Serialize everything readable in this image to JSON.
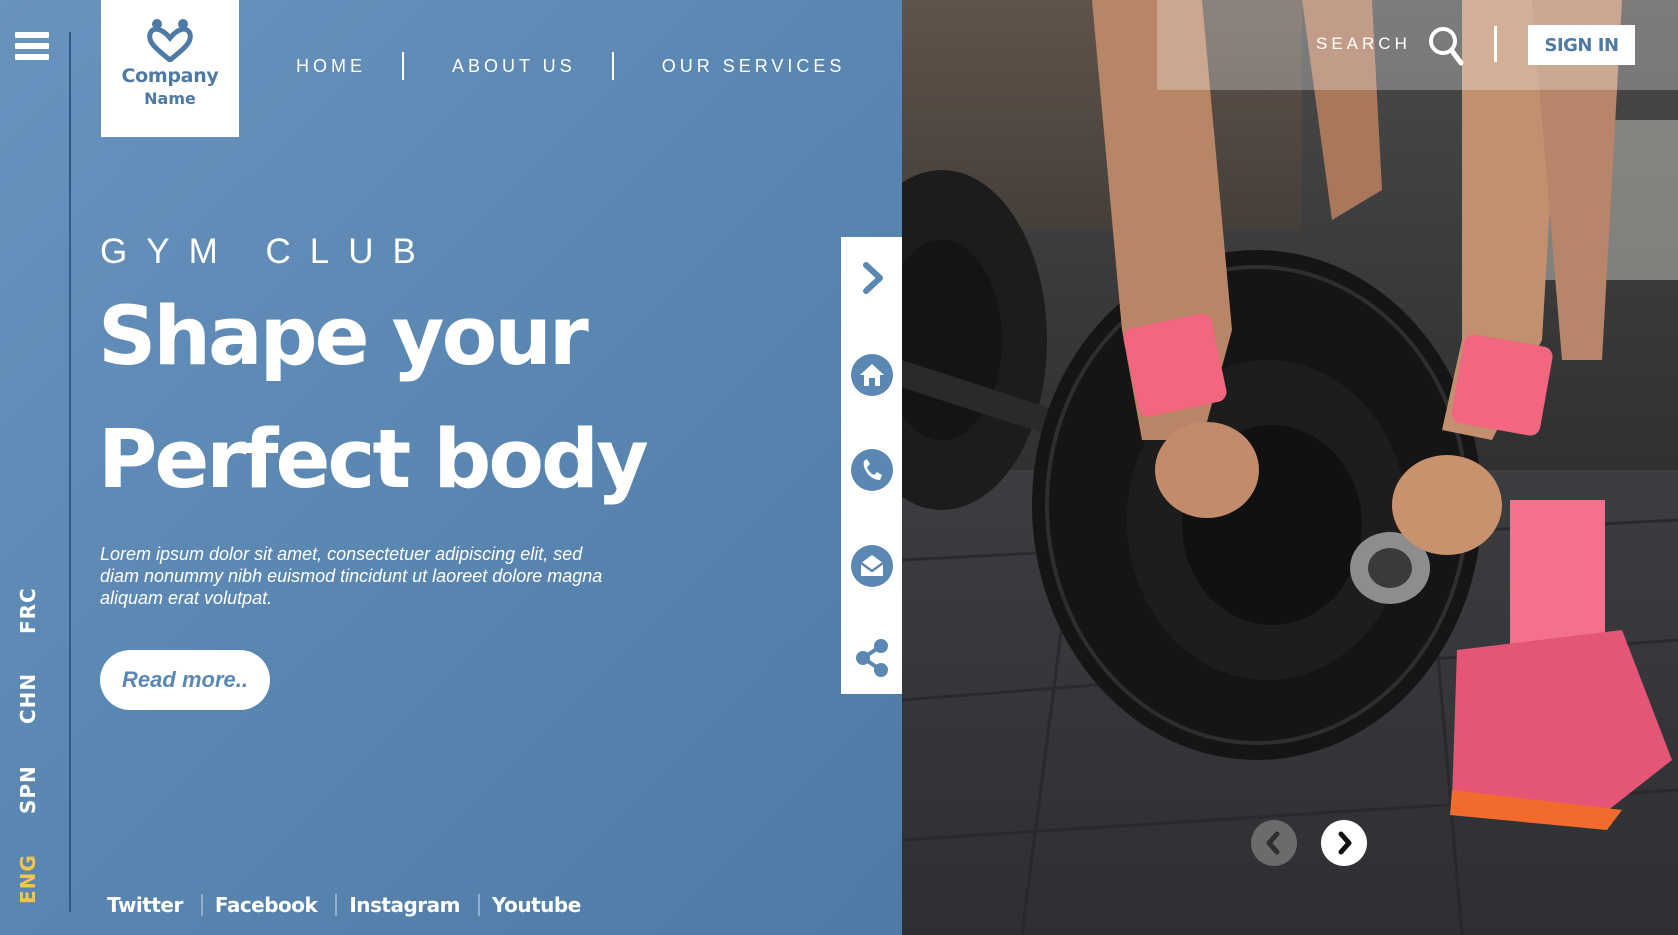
{
  "brand": {
    "line1": "Company",
    "line2": "Name"
  },
  "nav": {
    "items": [
      "HOME",
      "ABOUT US",
      "OUR SERVICES"
    ]
  },
  "hero": {
    "kicker": "GYM CLUB",
    "headline_line1": "Shape your",
    "headline_line2": "Perfect body",
    "body": "Lorem ipsum dolor sit amet, consectetuer adipiscing elit, sed diam nonummy nibh euismod tincidunt ut laoreet dolore magna aliquam erat volutpat.",
    "cta": "Read more.."
  },
  "languages": [
    "FRC",
    "CHN",
    "SPN",
    "ENG"
  ],
  "active_language": "ENG",
  "social": [
    "Twitter",
    "Facebook",
    "Instagram",
    "Youtube"
  ],
  "header_right": {
    "search_label": "SEARCH",
    "sign_in": "SIGN IN"
  },
  "toolbar_icons": [
    "chevron-right-icon",
    "home-icon",
    "phone-icon",
    "mail-icon",
    "share-icon"
  ],
  "carousel": {
    "prev_icon": "chevron-left-icon",
    "next_icon": "chevron-right-icon"
  },
  "colors": {
    "panel": "#5b87b3",
    "accent_lang": "#f3c44e",
    "brand_blue": "#4f7aa6"
  }
}
